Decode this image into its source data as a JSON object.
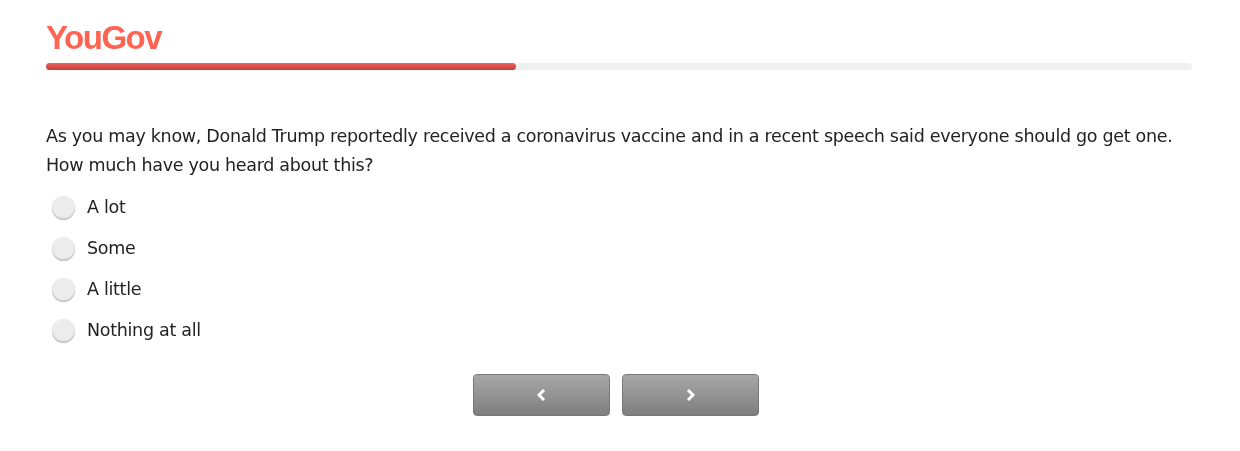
{
  "logo": "YouGov",
  "progress": {
    "level": 0.41
  },
  "question": "As you may know, Donald Trump reportedly received a coronavirus vaccine and in a recent speech said everyone should go get one. How much have you heard about this?",
  "options": [
    {
      "label": "A lot",
      "selected": false
    },
    {
      "label": "Some",
      "selected": false
    },
    {
      "label": "A little",
      "selected": false
    },
    {
      "label": "Nothing at all",
      "selected": false
    }
  ],
  "nav": [
    {
      "kind": "back"
    },
    {
      "kind": "next"
    }
  ]
}
